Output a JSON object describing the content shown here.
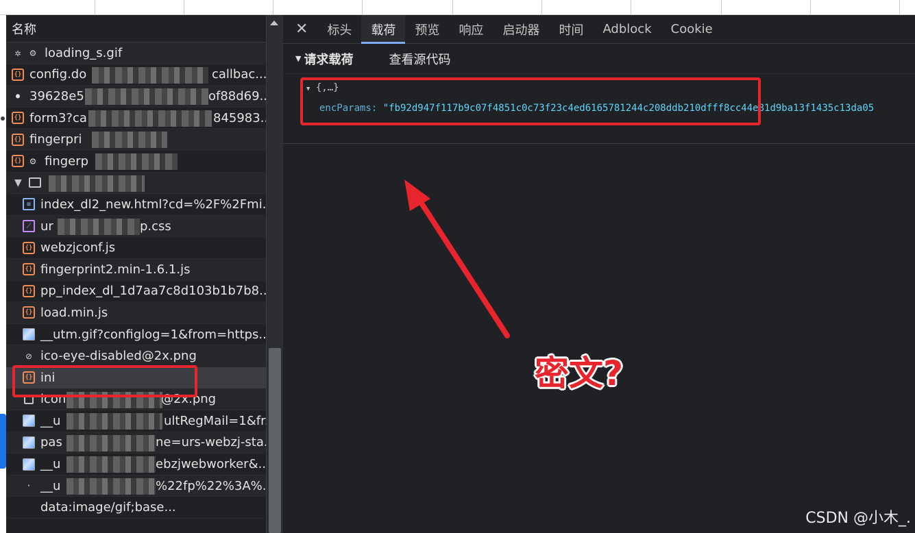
{
  "request_list": {
    "header": "名称",
    "rows": [
      {
        "name": "loading_s.gif",
        "icon": "gear-icon"
      },
      {
        "name": "config.do",
        "suffix": "callbac...",
        "icon": "js-icon"
      },
      {
        "name": "39628e5",
        "suffix": "of88d69...",
        "icon": "bullet-icon"
      },
      {
        "name": "form3?ca",
        "suffix": "845983...",
        "icon": "js-icon"
      },
      {
        "name": "fingerpri",
        "suffix": "",
        "icon": "js-icon"
      },
      {
        "name": "fingerp",
        "suffix": "",
        "icon": "js-icon"
      },
      {
        "name": "",
        "suffix": "",
        "icon": "group-icon"
      },
      {
        "name": "index_dl2_new.html?cd=%2F%2Fmi...",
        "icon": "document-icon"
      },
      {
        "name": "ur",
        "suffix": "p.css",
        "icon": "css-icon"
      },
      {
        "name": "webzjconf.js",
        "icon": "js-icon"
      },
      {
        "name": "fingerprint2.min-1.6.1.js",
        "icon": "js-icon"
      },
      {
        "name": "pp_index_dl_1d7aa7c8d103b1b7b8...",
        "icon": "js-icon"
      },
      {
        "name": "load.min.js",
        "icon": "js-icon"
      },
      {
        "name": "__utm.gif?configlog=1&from=https...",
        "icon": "image-icon"
      },
      {
        "name": "ico-eye-disabled@2x.png",
        "icon": "image-icon"
      },
      {
        "name": "ini",
        "icon": "js-icon"
      },
      {
        "name": "icon",
        "suffix": "@2x.png",
        "icon": "checkbox-image-icon"
      },
      {
        "name": "__u",
        "suffix": "ultRegMail=1&fr...",
        "icon": "image-icon"
      },
      {
        "name": "pas",
        "suffix": "ne=urs-webzj-sta...",
        "icon": "image-icon"
      },
      {
        "name": "__u",
        "suffix": "ebzjwebworker&...",
        "icon": "image-icon"
      },
      {
        "name": "__u",
        "suffix": "%22fp%22%3A%...",
        "icon": "dot-icon"
      },
      {
        "name": "data:image/gif;base...",
        "icon": "blank-icon"
      }
    ]
  },
  "detail": {
    "tabs": [
      "标头",
      "载荷",
      "预览",
      "响应",
      "启动器",
      "时间",
      "Adblock",
      "Cookie"
    ],
    "active_tab": "载荷",
    "payload_title": "请求载荷",
    "view_source": "查看源代码",
    "object_summary": "{,…}",
    "param_key": "encParams",
    "param_value": "\"fb92d947f117b9c07f4851c0c73f23c4ed6165781244c208ddb210dfff8",
    "param_value_tail": "cc44e81d9ba13f1435c13da05"
  },
  "annotation": {
    "text": "密文?",
    "color": "#e8242c"
  },
  "watermark": "CSDN @小木_."
}
